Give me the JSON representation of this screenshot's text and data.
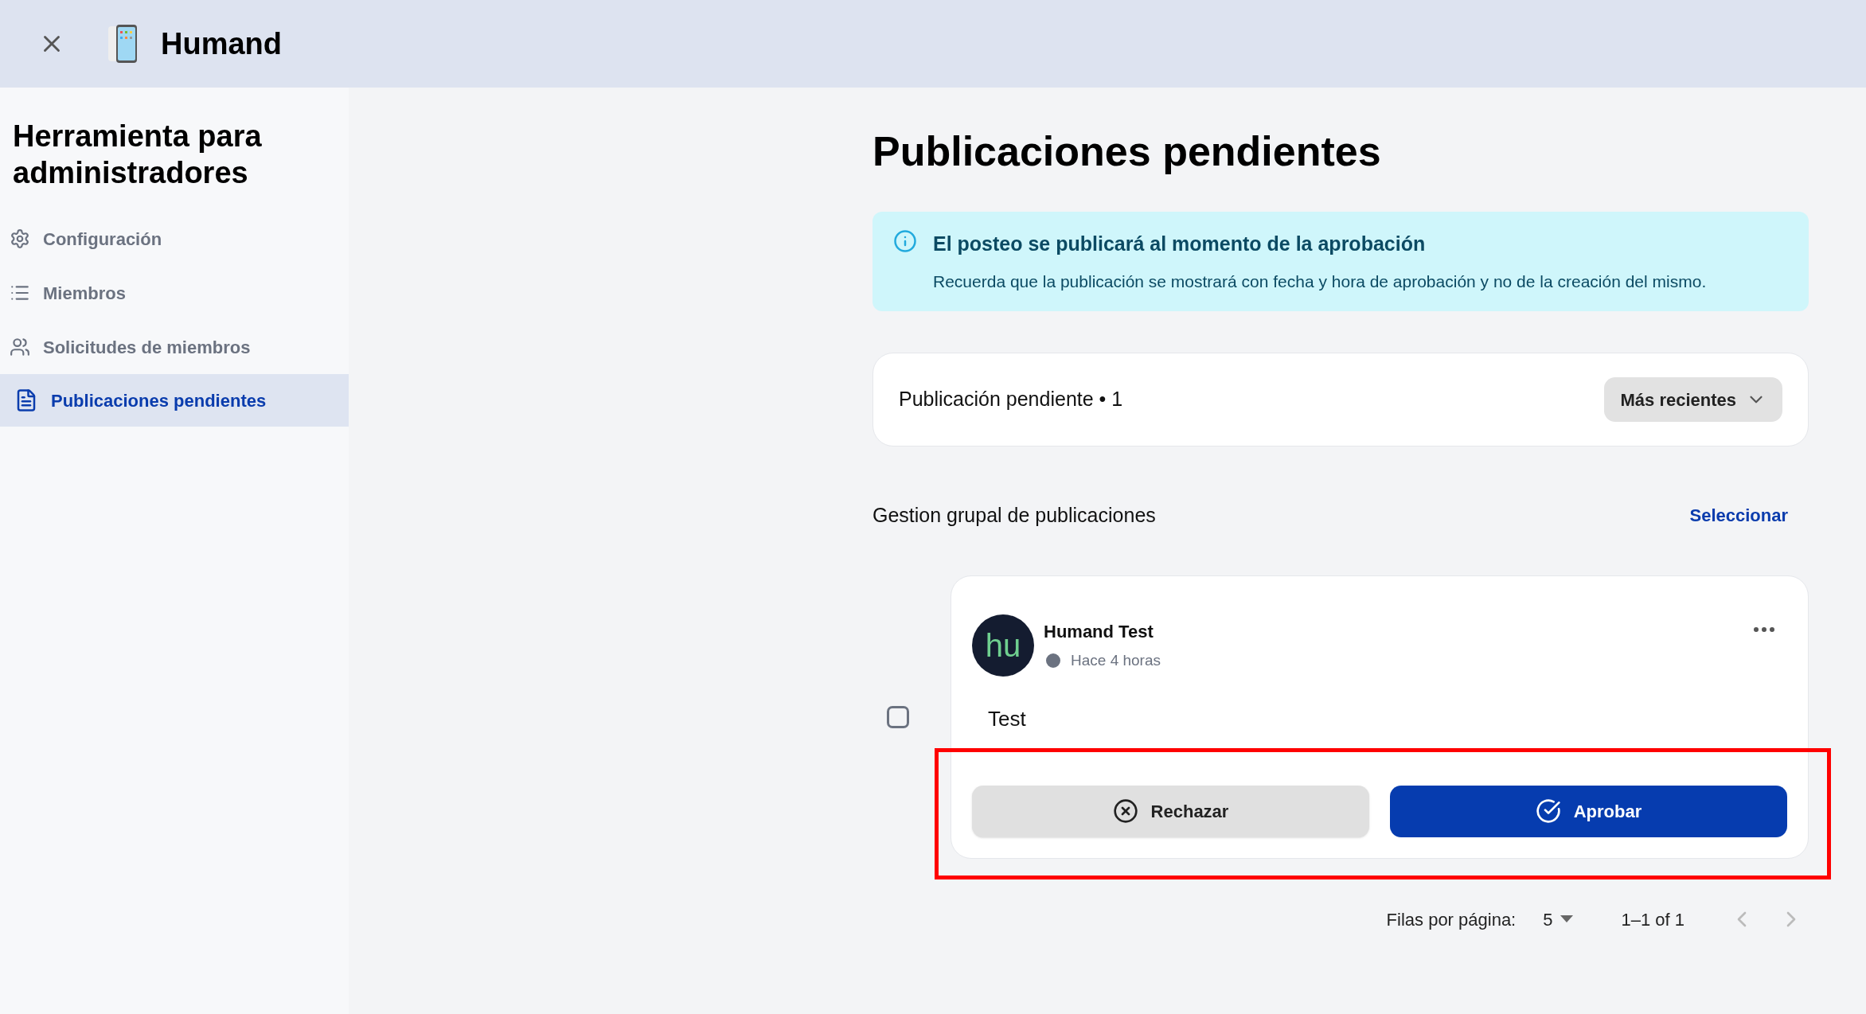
{
  "header": {
    "title": "Humand"
  },
  "sidebar": {
    "title": "Herramienta para administradores",
    "items": [
      {
        "label": "Configuración",
        "selected": false
      },
      {
        "label": "Miembros",
        "selected": false
      },
      {
        "label": "Solicitudes de miembros",
        "selected": false
      },
      {
        "label": "Publicaciones pendientes",
        "selected": true
      }
    ]
  },
  "page_title": "Publicaciones pendientes",
  "info": {
    "title": "El posteo se publicará al momento de la aprobación",
    "text": "Recuerda que la publicación se mostrará con fecha y hora de aprobación y no de la creación del mismo."
  },
  "count_card": {
    "label": "Publicación pendiente • 1",
    "sort": "Más recientes"
  },
  "bulk": {
    "label": "Gestion grupal de publicaciones",
    "action": "Seleccionar"
  },
  "post": {
    "checked": false,
    "avatar": "hu",
    "author": "Humand Test",
    "time": "Hace 4 horas",
    "body": "Test",
    "reject": "Rechazar",
    "approve": "Aprobar",
    "actions_highlighted": true
  },
  "pagination": {
    "rows_label": "Filas por página:",
    "rows_value": "5",
    "range": "1–1 of 1",
    "prev_disabled": true,
    "next_disabled": true
  }
}
